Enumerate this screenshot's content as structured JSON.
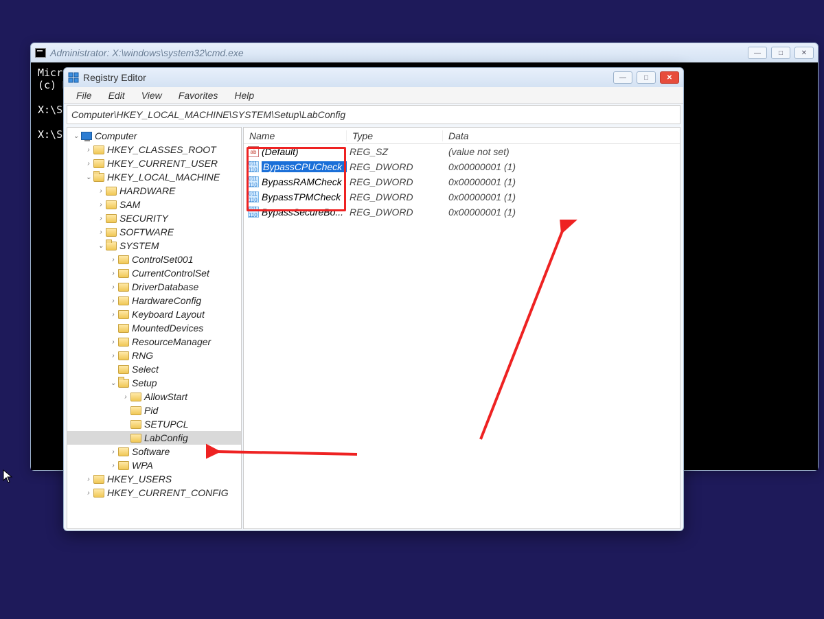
{
  "cmd": {
    "title": "Administrator: X:\\windows\\system32\\cmd.exe",
    "body": "Micro\n(c) M\n\nX:\\So\n\nX:\\So"
  },
  "regedit": {
    "title": "Registry Editor",
    "menu": [
      "File",
      "Edit",
      "View",
      "Favorites",
      "Help"
    ],
    "address": "Computer\\HKEY_LOCAL_MACHINE\\SYSTEM\\Setup\\LabConfig",
    "columns": {
      "name": "Name",
      "type": "Type",
      "data": "Data"
    },
    "tree": {
      "root": "Computer",
      "hives": [
        {
          "label": "HKEY_CLASSES_ROOT",
          "expanded": false,
          "hasChildren": true
        },
        {
          "label": "HKEY_CURRENT_USER",
          "expanded": false,
          "hasChildren": true
        },
        {
          "label": "HKEY_LOCAL_MACHINE",
          "expanded": true,
          "hasChildren": true,
          "children": [
            {
              "label": "HARDWARE",
              "hasChildren": true
            },
            {
              "label": "SAM",
              "hasChildren": true
            },
            {
              "label": "SECURITY",
              "hasChildren": true
            },
            {
              "label": "SOFTWARE",
              "hasChildren": true
            },
            {
              "label": "SYSTEM",
              "expanded": true,
              "hasChildren": true,
              "children": [
                {
                  "label": "ControlSet001",
                  "hasChildren": true
                },
                {
                  "label": "CurrentControlSet",
                  "hasChildren": true
                },
                {
                  "label": "DriverDatabase",
                  "hasChildren": true
                },
                {
                  "label": "HardwareConfig",
                  "hasChildren": true
                },
                {
                  "label": "Keyboard Layout",
                  "hasChildren": true
                },
                {
                  "label": "MountedDevices"
                },
                {
                  "label": "ResourceManager",
                  "hasChildren": true
                },
                {
                  "label": "RNG",
                  "hasChildren": true
                },
                {
                  "label": "Select"
                },
                {
                  "label": "Setup",
                  "expanded": true,
                  "hasChildren": true,
                  "children": [
                    {
                      "label": "AllowStart",
                      "hasChildren": true
                    },
                    {
                      "label": "Pid"
                    },
                    {
                      "label": "SETUPCL"
                    },
                    {
                      "label": "LabConfig",
                      "selected": true
                    }
                  ]
                },
                {
                  "label": "Software",
                  "hasChildren": true
                },
                {
                  "label": "WPA",
                  "hasChildren": true
                }
              ]
            }
          ]
        },
        {
          "label": "HKEY_USERS",
          "expanded": false,
          "hasChildren": true
        },
        {
          "label": "HKEY_CURRENT_CONFIG",
          "expanded": false,
          "hasChildren": true
        }
      ]
    },
    "values": [
      {
        "name": "(Default)",
        "type": "REG_SZ",
        "data": "(value not set)",
        "icon": "sz",
        "selected": false
      },
      {
        "name": "BypassCPUCheck",
        "type": "REG_DWORD",
        "data": "0x00000001 (1)",
        "icon": "dw",
        "selected": true
      },
      {
        "name": "BypassRAMCheck",
        "type": "REG_DWORD",
        "data": "0x00000001 (1)",
        "icon": "dw",
        "selected": false
      },
      {
        "name": "BypassTPMCheck",
        "type": "REG_DWORD",
        "data": "0x00000001 (1)",
        "icon": "dw",
        "selected": false
      },
      {
        "name": "BypassSecureBo...",
        "type": "REG_DWORD",
        "data": "0x00000001 (1)",
        "icon": "dw",
        "selected": false
      }
    ]
  }
}
